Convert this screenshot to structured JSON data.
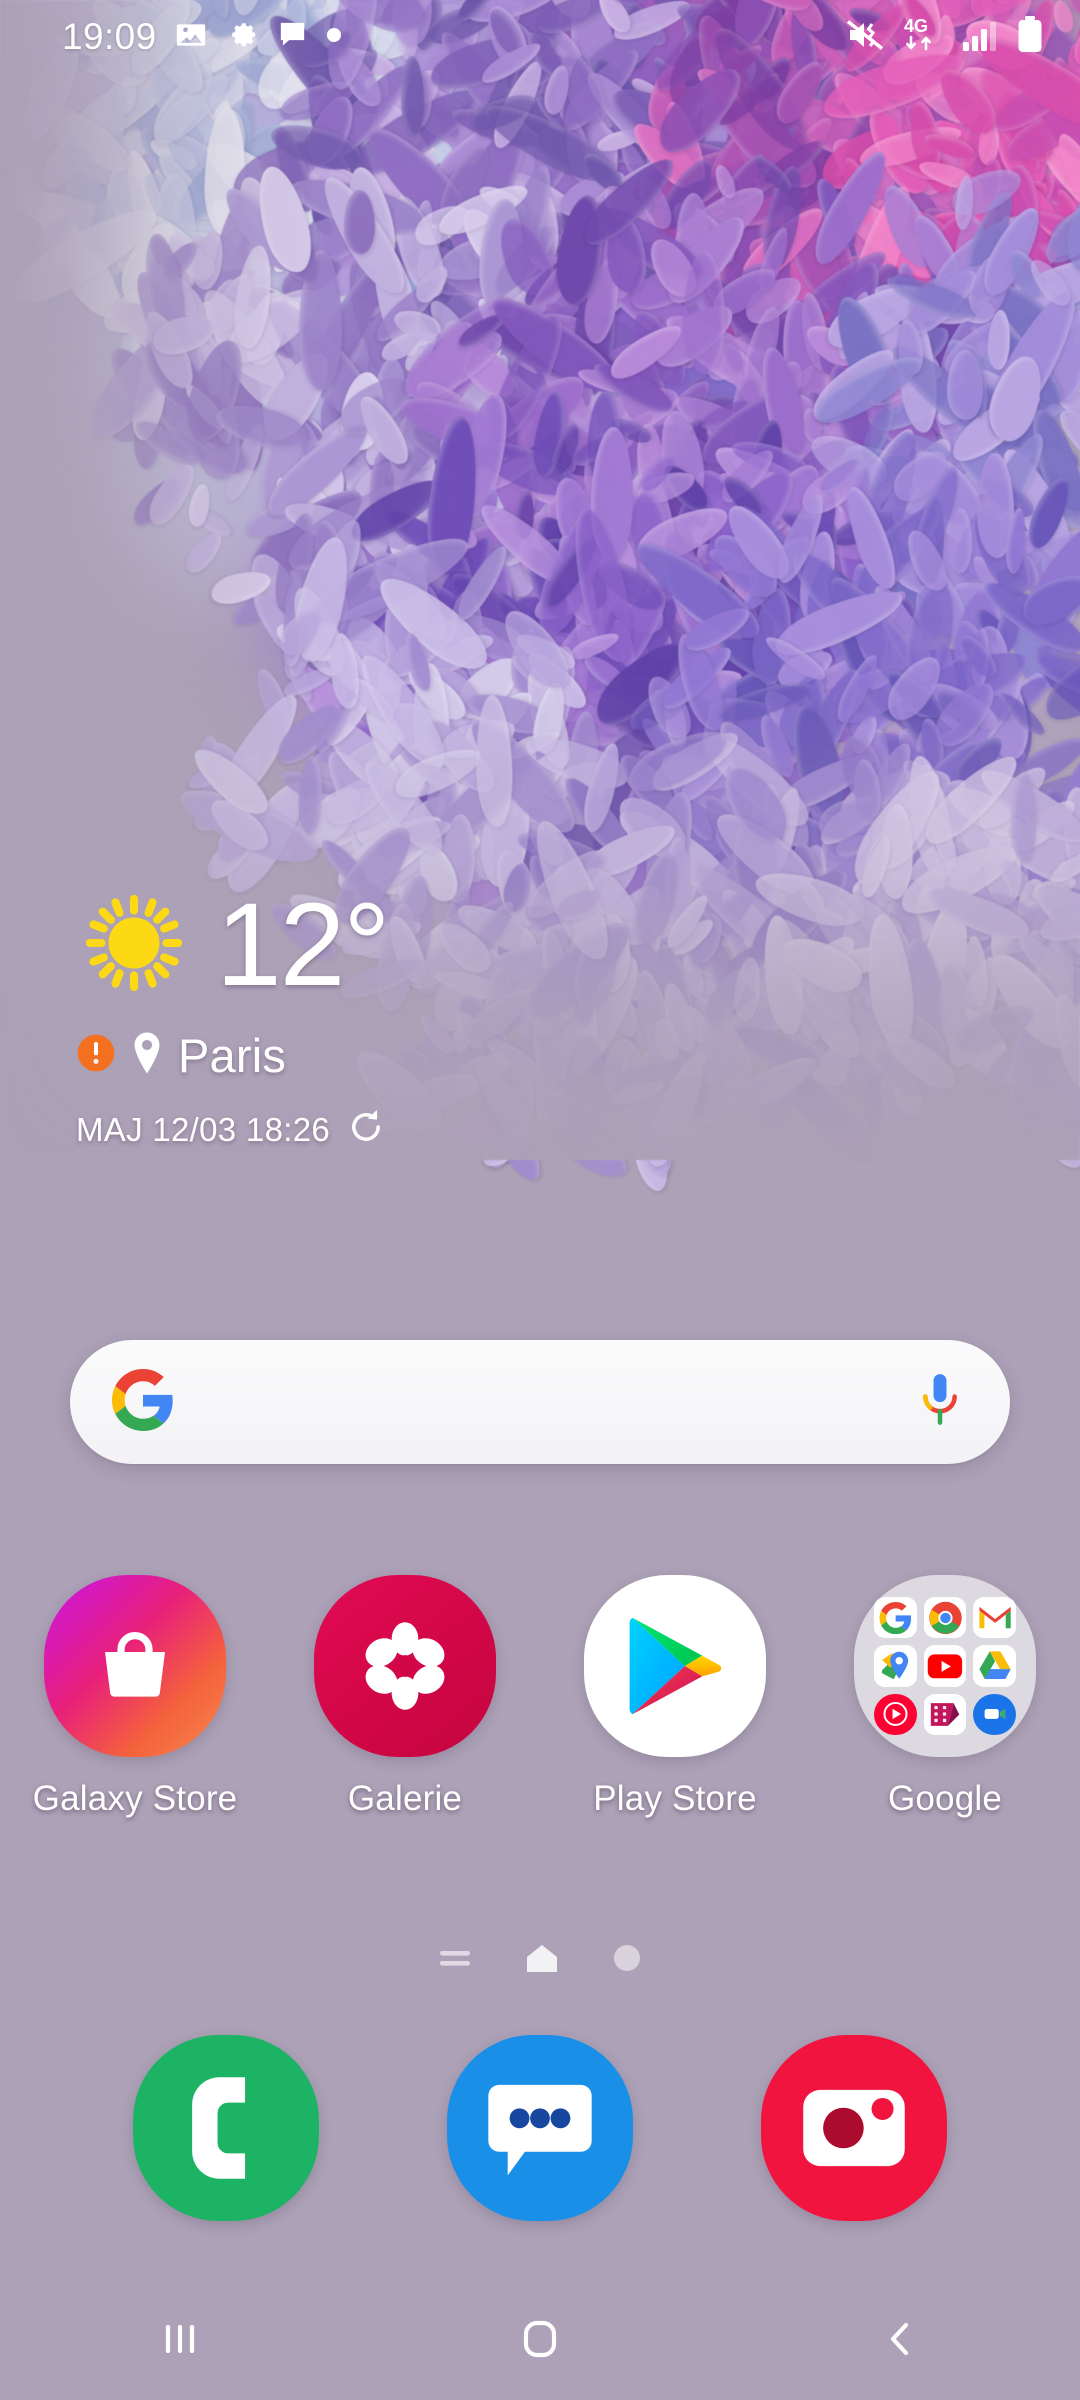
{
  "status_bar": {
    "time": "19:09",
    "left_icons": [
      {
        "name": "image-icon",
        "glyph": "image"
      },
      {
        "name": "gear-icon",
        "glyph": "gear"
      },
      {
        "name": "message-icon",
        "glyph": "message"
      },
      {
        "name": "dot-icon",
        "glyph": "dot"
      }
    ],
    "right_icons": [
      {
        "name": "mute-vibrate-icon",
        "glyph": "mute"
      },
      {
        "name": "network-4g-icon",
        "glyph": "4g",
        "label": "4G"
      },
      {
        "name": "signal-bars-icon",
        "glyph": "signal"
      },
      {
        "name": "battery-icon",
        "glyph": "battery"
      }
    ]
  },
  "weather": {
    "icon": "sun-icon",
    "temperature": "12°",
    "alert_icon": "alert-circle-icon",
    "location_icon": "location-pin-icon",
    "city": "Paris",
    "updated": "MAJ 12/03 18:26",
    "refresh_icon": "refresh-icon",
    "sun_color": "#FCD914",
    "alert_color": "#F2701F"
  },
  "search": {
    "logo": "google-g-icon",
    "placeholder": "",
    "value": "",
    "mic_icon": "microphone-icon"
  },
  "apps": [
    {
      "name": "galaxy-store",
      "label": "Galaxy Store",
      "icon": "shopping-bag-icon",
      "color": "#E8347C"
    },
    {
      "name": "galerie",
      "label": "Galerie",
      "icon": "flower-icon",
      "color": "#DC0A4B"
    },
    {
      "name": "play-store",
      "label": "Play Store",
      "icon": "play-triangle-icon",
      "color": "#FFFFFF"
    },
    {
      "name": "google-folder",
      "label": "Google",
      "icon": "folder-icon",
      "color": "#E4E2E8"
    }
  ],
  "folder_items": [
    {
      "name": "google-icon",
      "label": "Google"
    },
    {
      "name": "chrome-icon",
      "label": "Chrome"
    },
    {
      "name": "gmail-icon",
      "label": "Gmail"
    },
    {
      "name": "maps-icon",
      "label": "Maps"
    },
    {
      "name": "youtube-icon",
      "label": "YouTube"
    },
    {
      "name": "drive-icon",
      "label": "Drive"
    },
    {
      "name": "youtube-music-icon",
      "label": "YT Music"
    },
    {
      "name": "play-movies-icon",
      "label": "Play Movies"
    },
    {
      "name": "duo-icon",
      "label": "Duo"
    }
  ],
  "page_indicator": {
    "pages": [
      {
        "name": "page-discover",
        "type": "list",
        "active": false
      },
      {
        "name": "page-home",
        "type": "house",
        "active": true
      },
      {
        "name": "page-extra",
        "type": "dot",
        "active": false
      }
    ]
  },
  "dock": [
    {
      "name": "phone",
      "icon": "phone-handset-icon",
      "color": "#1CB464"
    },
    {
      "name": "messages",
      "icon": "chat-bubble-icon",
      "color": "#1A8FE8"
    },
    {
      "name": "camera",
      "icon": "camera-icon",
      "color": "#F0143F"
    }
  ],
  "nav_bar": [
    {
      "name": "recents-button",
      "icon": "recents-bars-icon"
    },
    {
      "name": "home-button",
      "icon": "home-square-icon"
    },
    {
      "name": "back-button",
      "icon": "chevron-left-icon"
    }
  ],
  "theme": {
    "background": "#aca1b6",
    "text_on_wallpaper": "#ffffff"
  }
}
